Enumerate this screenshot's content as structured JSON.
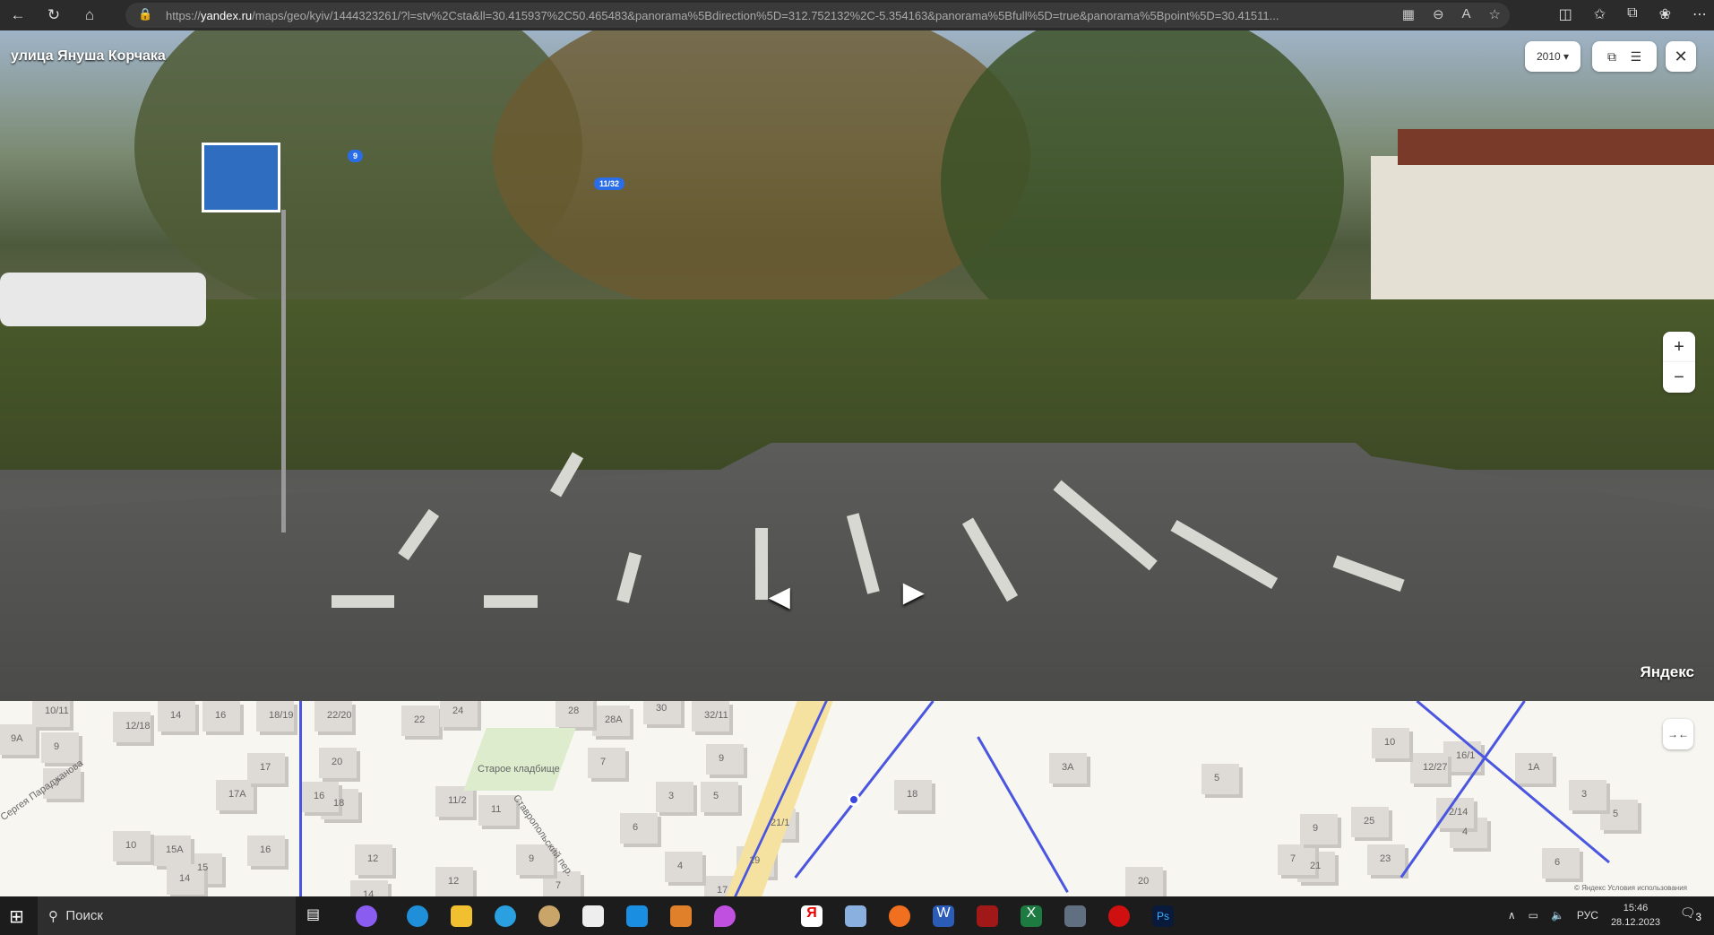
{
  "browser": {
    "url_prefix": "https://",
    "url_domain": "yandex.ru",
    "url_rest": "/maps/geo/kyiv/1444323261/?l=stv%2Csta&ll=30.415937%2C50.465483&panorama%5Bdirection%5D=312.752132%2C-5.354163&panorama%5Bfull%5D=true&panorama%5Bpoint%5D=30.41511..."
  },
  "panorama": {
    "street_title": "улица Януша Корчака",
    "year": "2010",
    "brand": "Яндекс",
    "badges": [
      "9",
      "11/32"
    ],
    "zoom_in": "+",
    "zoom_out": "−"
  },
  "map": {
    "labels": [
      "10/11",
      "14",
      "16",
      "18/19",
      "22/20",
      "24",
      "22",
      "28",
      "28А",
      "30",
      "32/11",
      "12/18",
      "9А",
      "9",
      "7",
      "17",
      "16",
      "17А",
      "20",
      "18",
      "7",
      "9",
      "3",
      "5",
      "11/2",
      "11",
      "6",
      "21/1",
      "19",
      "14",
      "12",
      "10",
      "15А",
      "15",
      "16",
      "12",
      "9",
      "4",
      "7",
      "17",
      "18",
      "20",
      "3А",
      "5",
      "10",
      "12/27",
      "16/1",
      "1А",
      "3",
      "5",
      "9",
      "7",
      "25",
      "23",
      "21",
      "2/14",
      "4",
      "6",
      "14"
    ],
    "place": "Старое кладбище",
    "street1": "Сергея Параджанова",
    "street2": "Ставропольский пер.",
    "copyright": "© Яндекс  Условия использования"
  },
  "taskbar": {
    "search": "Поиск",
    "lang": "РУС",
    "time": "15:46",
    "date": "28.12.2023",
    "notif": "3"
  }
}
